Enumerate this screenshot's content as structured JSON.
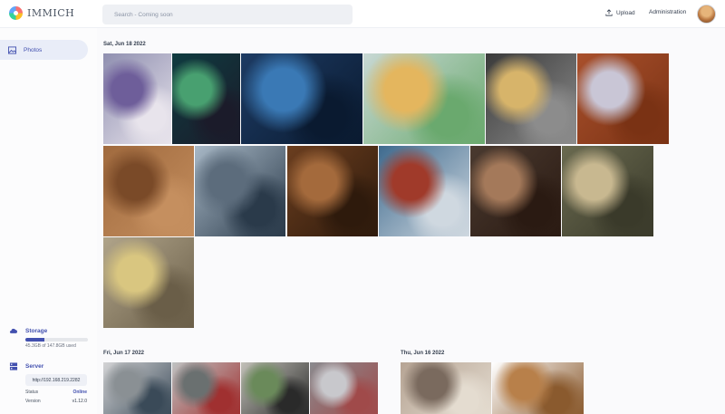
{
  "app": {
    "name": "IMMICH"
  },
  "header": {
    "search_placeholder": "Search - Coming soon",
    "upload_label": "Upload",
    "admin_label": "Administration"
  },
  "sidebar": {
    "photos_label": "Photos",
    "storage": {
      "title": "Storage",
      "usage_text": "45.3GB of 147.8GB used",
      "used_fraction": 0.306
    },
    "server": {
      "title": "Server",
      "url": "http://192.168.219.2282",
      "status_label": "Status",
      "status_value": "Online",
      "version_label": "Version",
      "version_value": "v1.12.0"
    }
  },
  "groups": [
    {
      "date": "Sat, Jun 18 2022",
      "photos": [
        {
          "name": "tablet-screen-photo",
          "colors": [
            "#8f8fb0",
            "#6e5e9a",
            "#e8e4ec"
          ]
        },
        {
          "name": "led-floor-photo",
          "colors": [
            "#0f3b40",
            "#48a070",
            "#1b1b2a"
          ]
        },
        {
          "name": "neon-room-photo",
          "colors": [
            "#1d3b63",
            "#3a79b5",
            "#0a1a30"
          ]
        },
        {
          "name": "play-table-photo",
          "colors": [
            "#c8d8d4",
            "#e4b65e",
            "#6aa96e"
          ]
        },
        {
          "name": "pasta-jar-photo",
          "colors": [
            "#3a3a3a",
            "#d7b46a",
            "#8c8c8c"
          ]
        },
        {
          "name": "gloves-beans-photo",
          "colors": [
            "#a9502c",
            "#c9c6d6",
            "#7a3214"
          ]
        },
        {
          "name": "almonds-photo",
          "colors": [
            "#a06a3e",
            "#7a4a28",
            "#c58f5f"
          ]
        },
        {
          "name": "cargo-ship-photo",
          "colors": [
            "#a8b8c6",
            "#5c6c7c",
            "#2a3a4a"
          ]
        },
        {
          "name": "hazelnuts-photo",
          "colors": [
            "#6b3e1f",
            "#a46a3c",
            "#2e1a0c"
          ]
        },
        {
          "name": "containers-photo",
          "colors": [
            "#3e6a8e",
            "#a03a2a",
            "#cfd8e0"
          ]
        },
        {
          "name": "coffee-roaster-photo",
          "colors": [
            "#4a3a30",
            "#a4795a",
            "#2a1a12"
          ]
        },
        {
          "name": "spice-jars-photo",
          "colors": [
            "#6a6a50",
            "#c8b890",
            "#3a3a2a"
          ]
        },
        {
          "name": "dry-goods-jars-photo",
          "colors": [
            "#b0a48a",
            "#d9c680",
            "#6a5e48"
          ]
        }
      ]
    },
    {
      "date": "Fri, Jun 17 2022",
      "photos": [
        {
          "name": "server-rack-photo",
          "colors": [
            "#d4d4d6",
            "#8a9094",
            "#3a4a58"
          ]
        },
        {
          "name": "wiring-panel-photo",
          "colors": [
            "#bfc2c2",
            "#6a7070",
            "#a03030"
          ]
        },
        {
          "name": "circuit-board-photo",
          "colors": [
            "#c2c0b8",
            "#6a8a5a",
            "#2a2a2a"
          ]
        },
        {
          "name": "cable-bundle-photo",
          "colors": [
            "#8a8a8e",
            "#c8c8cc",
            "#a04a4a"
          ]
        }
      ]
    },
    {
      "date": "Thu, Jun 16 2022",
      "photos": [
        {
          "name": "mirror-selfie-photo",
          "colors": [
            "#b6a494",
            "#7a6a5e",
            "#e4dcd0"
          ]
        },
        {
          "name": "teddy-bear-photo",
          "colors": [
            "#ffffff",
            "#b8804a",
            "#8a5a2e"
          ]
        }
      ]
    }
  ]
}
